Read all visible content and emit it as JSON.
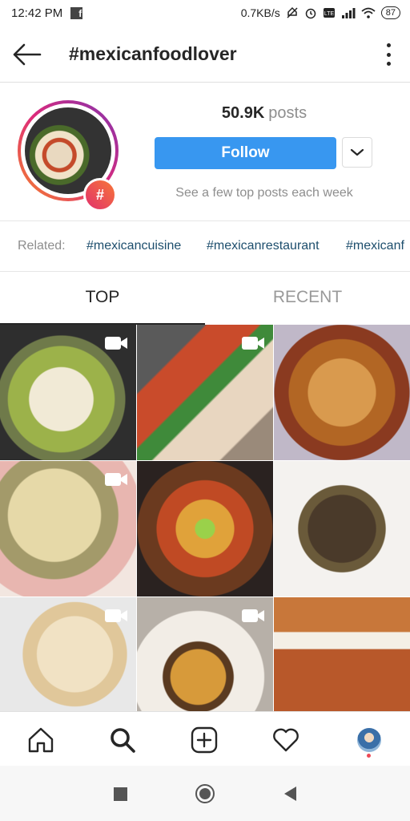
{
  "status_bar": {
    "time": "12:42 PM",
    "network_speed": "0.7KB/s",
    "battery": "87",
    "notification_icon": "facebook-icon"
  },
  "header": {
    "title": "#mexicanfoodlover",
    "back_icon": "back-arrow-icon",
    "menu_icon": "more-vertical-icon"
  },
  "profile": {
    "posts_count": "50.9K",
    "posts_label": "posts",
    "follow_label": "Follow",
    "hint": "See a few top posts each week",
    "badge_symbol": "#"
  },
  "related": {
    "label": "Related:",
    "tags": [
      "#mexicancuisine",
      "#mexicanrestaurant",
      "#mexicanf"
    ]
  },
  "tabs": [
    {
      "label": "TOP",
      "active": true
    },
    {
      "label": "RECENT",
      "active": false
    }
  ],
  "grid": {
    "items": [
      {
        "subject": "pozole soup",
        "video": true
      },
      {
        "subject": "tacos with salsa",
        "video": true
      },
      {
        "subject": "birria tacos",
        "video": false
      },
      {
        "subject": "esquites corn",
        "video": true
      },
      {
        "subject": "street tacos",
        "video": false
      },
      {
        "subject": "mole enchiladas",
        "video": false
      },
      {
        "subject": "tortillas",
        "video": true
      },
      {
        "subject": "conchas",
        "video": true
      },
      {
        "subject": "churro sandwich",
        "video": false
      }
    ]
  },
  "bottom_nav": [
    "home-icon",
    "search-icon",
    "add-post-icon",
    "activity-heart-icon",
    "profile-avatar-icon"
  ],
  "system_nav": [
    "recents-icon",
    "home-circle-icon",
    "back-triangle-icon"
  ],
  "colors": {
    "follow_blue": "#3897f0",
    "hashtag_link": "#1d4e6d",
    "badge_gradient_start": "#e1306c",
    "badge_gradient_end": "#f77737"
  }
}
